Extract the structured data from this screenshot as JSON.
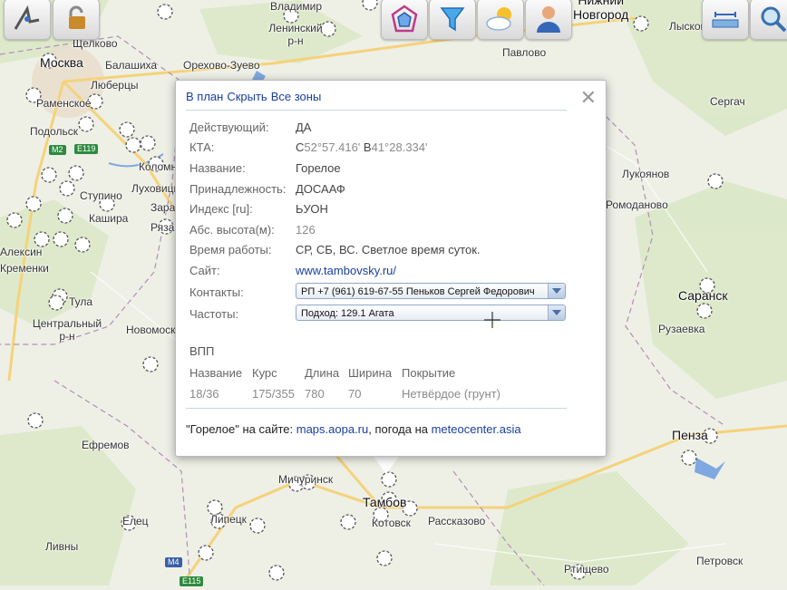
{
  "map": {
    "cities": [
      {
        "id": "vladimir",
        "name": "Владимир",
        "big": false
      },
      {
        "id": "leninsky",
        "name": "Ленинский\nр-н",
        "big": false
      },
      {
        "id": "n-novgorod",
        "name": "Нижний\nНовгород",
        "big": true
      },
      {
        "id": "lyskovo",
        "name": "Лысково",
        "big": false
      },
      {
        "id": "pavlovo",
        "name": "Павлово",
        "big": false
      },
      {
        "id": "shchelkovo",
        "name": "Щелково",
        "big": false
      },
      {
        "id": "moskva",
        "name": "Москва",
        "big": true
      },
      {
        "id": "balashikha",
        "name": "Балашиха",
        "big": false
      },
      {
        "id": "orekhovo",
        "name": "Орехово-Зуево",
        "big": false
      },
      {
        "id": "lyubertsy",
        "name": "Люберцы",
        "big": false
      },
      {
        "id": "ramenskoe",
        "name": "Раменское",
        "big": false
      },
      {
        "id": "podolsk",
        "name": "Подольск",
        "big": false
      },
      {
        "id": "serach",
        "name": "Сергач",
        "big": false
      },
      {
        "id": "lukoyanov",
        "name": "Лукоянов",
        "big": false
      },
      {
        "id": "kolomna",
        "name": "Коломна",
        "big": false
      },
      {
        "id": "lukhovitsy",
        "name": "Луховицы",
        "big": false
      },
      {
        "id": "stupino",
        "name": "Ступино",
        "big": false
      },
      {
        "id": "kashira",
        "name": "Кашира",
        "big": false
      },
      {
        "id": "zaraysk",
        "name": "Зарайск",
        "big": false
      },
      {
        "id": "ryazan",
        "name": "Рязань",
        "big": false
      },
      {
        "id": "romodanovo",
        "name": "Ромодановo",
        "big": false
      },
      {
        "id": "aleksin",
        "name": "Алексин",
        "big": false
      },
      {
        "id": "kremenki",
        "name": "Кременки",
        "big": false
      },
      {
        "id": "tula",
        "name": "Тула",
        "big": false
      },
      {
        "id": "saransk",
        "name": "Саранск",
        "big": true
      },
      {
        "id": "centralny",
        "name": "Центральный\nр-н",
        "big": false
      },
      {
        "id": "novomoskovsk",
        "name": "Новомосковск",
        "big": false
      },
      {
        "id": "ruzaevka",
        "name": "Рузаевка",
        "big": false
      },
      {
        "id": "penza",
        "name": "Пенза",
        "big": true
      },
      {
        "id": "efremov",
        "name": "Ефремов",
        "big": false
      },
      {
        "id": "michurinsk",
        "name": "Мичуринск",
        "big": false
      },
      {
        "id": "tambov",
        "name": "Тамбов",
        "big": true
      },
      {
        "id": "kotovsk",
        "name": "Котовск",
        "big": false
      },
      {
        "id": "rasskazovo",
        "name": "Рассказово",
        "big": false
      },
      {
        "id": "elets",
        "name": "Елец",
        "big": false
      },
      {
        "id": "lipetsk",
        "name": "Липецк",
        "big": false
      },
      {
        "id": "livny",
        "name": "Ливны",
        "big": false
      },
      {
        "id": "rtishchevo",
        "name": "Ртищево",
        "big": false
      },
      {
        "id": "petrovsk",
        "name": "Петровск",
        "big": false
      }
    ],
    "roads": [
      "M2",
      "E119",
      "M4",
      "E115"
    ]
  },
  "toolbar": {
    "icons": [
      "compass-icon",
      "unlock-icon",
      "airspace-icon",
      "filter-icon",
      "weather-icon",
      "profile-icon",
      "ruler-icon",
      "search-icon"
    ]
  },
  "popup": {
    "header_links": [
      "В план",
      "Скрыть",
      "Все зоны"
    ],
    "close": "✕",
    "fields": [
      {
        "key": "Действующий:",
        "value": "ДА",
        "muted": false
      },
      {
        "key": "КТА:",
        "value_parts": [
          "С",
          "52°57.416'",
          "В",
          "41°28.334'"
        ]
      },
      {
        "key": "Название:",
        "value": "Горелое",
        "muted": false
      },
      {
        "key": "Принадлежность:",
        "value": "ДОСААФ",
        "muted": false
      },
      {
        "key": "Индекс [ru]:",
        "value": "ЬУОН",
        "muted": false
      },
      {
        "key": "Абс. высота(м):",
        "value": "126",
        "muted": true
      },
      {
        "key": "Время работы:",
        "value": "СР, СБ, ВС. Светлое время суток.",
        "muted": false
      },
      {
        "key": "Сайт:",
        "link": "www.tambovsky.ru/"
      }
    ],
    "contacts": {
      "label": "Контакты:",
      "selected": "РП +7 (961) 619-67-55 Пеньков Сергей Федорович"
    },
    "frequencies": {
      "label": "Частоты:",
      "selected": "Подход: 129.1 Агата"
    },
    "runway": {
      "title": "ВПП",
      "headers": [
        "Название",
        "Курс",
        "Длина",
        "Ширина",
        "Покрытие"
      ],
      "values": [
        "18/36",
        "175/355",
        "780",
        "70",
        "Нетвёрдое (грунт)"
      ]
    },
    "footer": {
      "quote": "\"Горелое\"",
      "on_site": " на сайте: ",
      "link1": "maps.aopa.ru",
      "weather_on": ", погода на ",
      "link2": "meteocenter.asia"
    }
  },
  "colors": {
    "link": "#1a3fa0",
    "map_bg": "#eef0e8",
    "water": "#7fa8e0"
  }
}
